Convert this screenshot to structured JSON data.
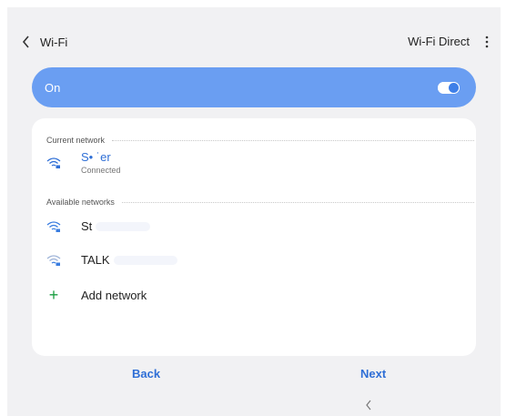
{
  "header": {
    "title": "Wi-Fi",
    "wifi_direct_label": "Wi-Fi Direct"
  },
  "master_toggle": {
    "label": "On",
    "state": "on",
    "bar_color": "#6a9ef2"
  },
  "current_network": {
    "section_label": "Current network",
    "name": "S• ˙er",
    "status": "Connected"
  },
  "available_networks": {
    "section_label": "Available networks",
    "items": [
      {
        "name": "St"
      },
      {
        "name": "TALK"
      }
    ]
  },
  "add_network": {
    "label": "Add network"
  },
  "footer": {
    "back_label": "Back",
    "next_label": "Next"
  },
  "colors": {
    "accent": "#2f6fd6",
    "add_icon": "#1a9e40",
    "background": "#f1f1f3"
  },
  "icons": {
    "back": "chevron-left-icon",
    "more": "more-vertical-icon",
    "wifi": "wifi-lock-icon",
    "add": "plus-icon",
    "nav_back": "chevron-left-icon"
  }
}
